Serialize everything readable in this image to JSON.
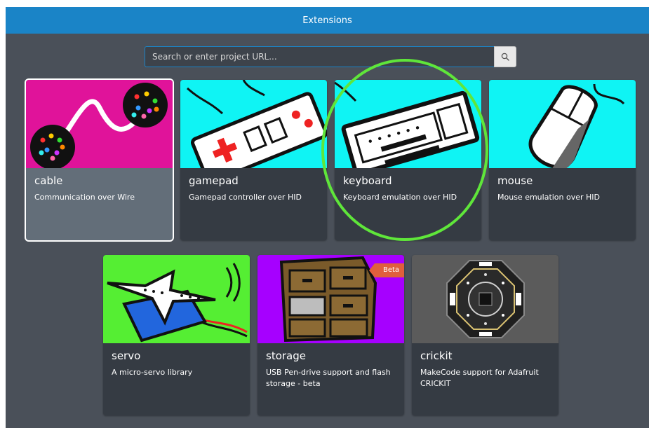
{
  "dialog": {
    "title": "Extensions"
  },
  "search": {
    "placeholder": "Search or enter project URL...",
    "icon": "search-icon"
  },
  "extensions": [
    {
      "title": "cable",
      "description": "Communication over Wire",
      "image_color": "#e0139a",
      "selected": true
    },
    {
      "title": "gamepad",
      "description": "Gamepad controller over HID",
      "image_color": "#0ff4f4"
    },
    {
      "title": "keyboard",
      "description": "Keyboard emulation over HID",
      "image_color": "#0ff4f4"
    },
    {
      "title": "mouse",
      "description": "Mouse emulation over HID",
      "image_color": "#0ff4f4"
    },
    {
      "title": "servo",
      "description": "A micro-servo library",
      "image_color": "#55ee33"
    },
    {
      "title": "storage",
      "description": "USB Pen-drive support and flash storage - beta",
      "image_color": "#a600ff",
      "badge": "Beta"
    },
    {
      "title": "crickit",
      "description": "MakeCode support for Adafruit CRICKIT",
      "image_color": "#5b5b5b"
    }
  ],
  "colors": {
    "header": "#1a84c7",
    "background": "#4a5059",
    "card": "#353b43",
    "highlight_ring": "#5fe63a",
    "badge": "#e05f3c"
  }
}
